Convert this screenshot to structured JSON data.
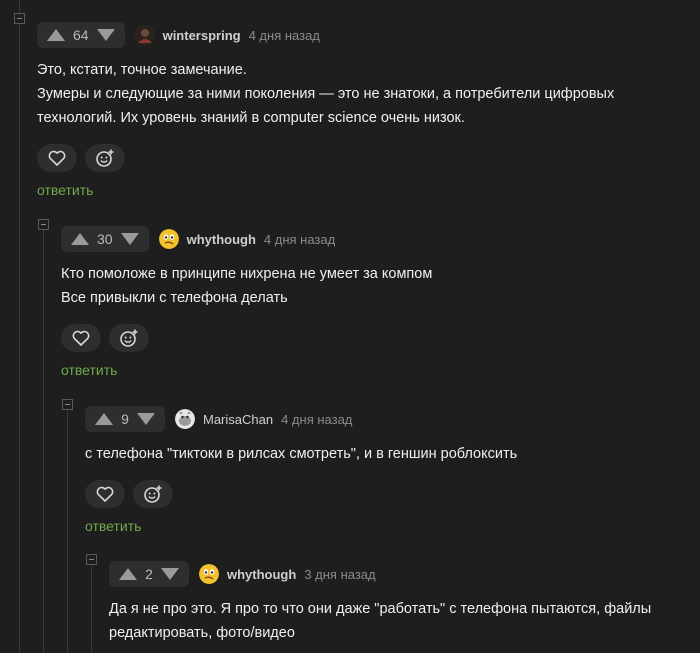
{
  "comments": [
    {
      "votes": "64",
      "username": "winterspring",
      "time": "4 дня назад",
      "lines": [
        "Это, кстати, точное замечание.",
        "Зумеры и следующие за ними поколения — это не знатоки, а потребители цифровых",
        "технологий. Их уровень знаний в computer science очень низок."
      ],
      "reply": "ответить"
    },
    {
      "votes": "30",
      "username": "whythough",
      "time": "4 дня назад",
      "lines": [
        "Кто помоложе в принципе нихрена не умеет за компом",
        "Все привыкли с телефона делать"
      ],
      "reply": "ответить"
    },
    {
      "votes": "9",
      "username": "MarisaChan",
      "time": "4 дня назад",
      "lines": [
        "с телефона \"тиктоки в рилсах смотреть\", и в геншин роблоксить"
      ],
      "reply": "ответить"
    },
    {
      "votes": "2",
      "username": "whythough",
      "time": "3 дня назад",
      "lines": [
        "Да я не про это. Я про то что они даже \"работать\" с телефона пытаются, файлы",
        "редактировать, фото/видео"
      ]
    }
  ],
  "icons": {
    "upvote": "upvote-icon",
    "downvote": "downvote-icon",
    "like": "heart-icon",
    "react": "emoji-add-icon",
    "collapse": "collapse-minus-icon"
  },
  "colors": {
    "background": "#1e1e1e",
    "pill": "#2e2e2e",
    "reply": "#6ea94b",
    "text": "#f0f0f0",
    "muted": "#8a8a8a"
  }
}
